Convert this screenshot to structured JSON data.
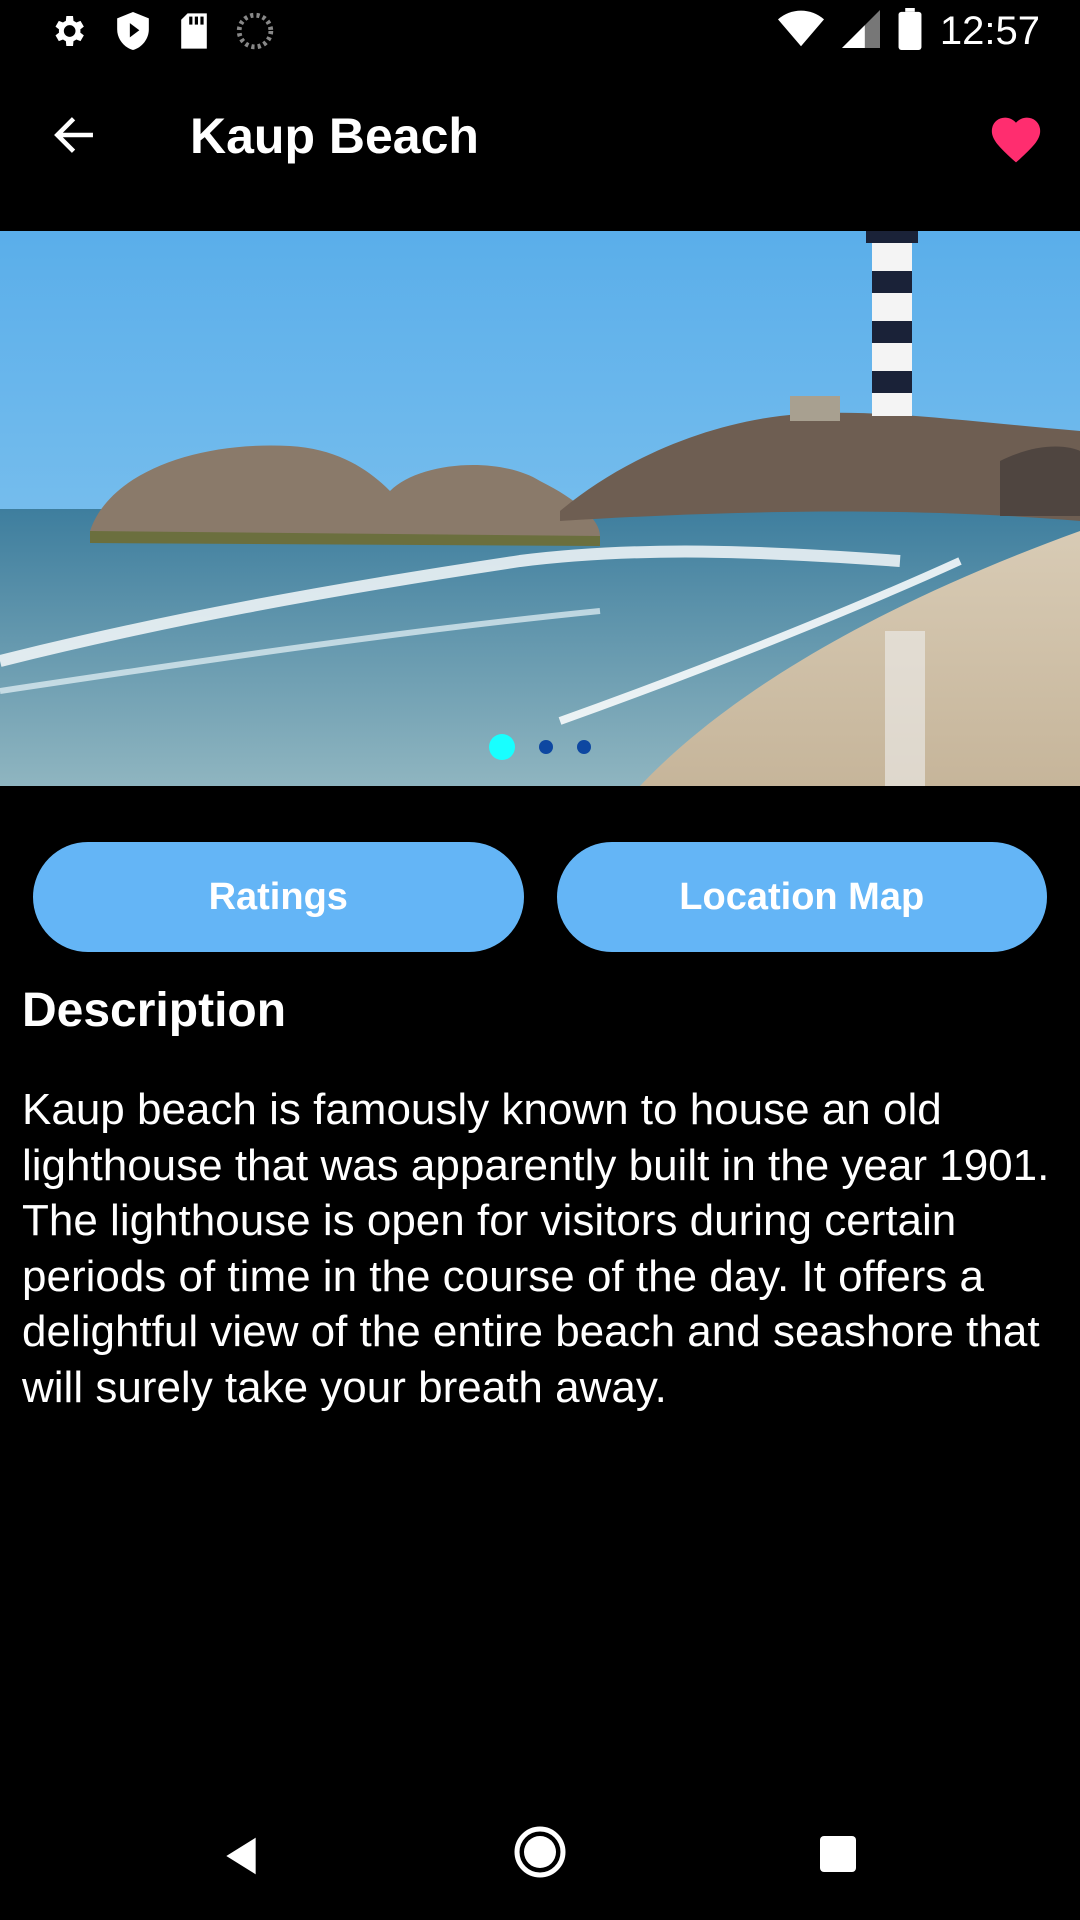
{
  "status_bar": {
    "time": "12:57",
    "left_icons": [
      "gear-icon",
      "shield-icon",
      "sd-card-icon",
      "loading-icon"
    ],
    "right_icons": [
      "wifi-icon",
      "signal-icon",
      "battery-icon"
    ]
  },
  "app_bar": {
    "title": "Kaup Beach",
    "back_icon": "arrow-back-icon",
    "favorite_icon": "heart-icon",
    "favorite_color": "#ff2d6f"
  },
  "carousel": {
    "image_alt": "Kaup beach lighthouse",
    "page_count": 3,
    "active_index": 0,
    "active_dot_color": "#18ffff",
    "inactive_dot_color": "#0d47a1"
  },
  "actions": {
    "ratings_label": "Ratings",
    "location_label": "Location Map",
    "button_color": "#64b5f6"
  },
  "description": {
    "heading": "Description",
    "body": "Kaup beach is famously known to house an old lighthouse that was apparently built in the year 1901. The lighthouse is open for visitors during certain periods of time in the course of the day. It offers a delightful view of the entire beach and seashore that will surely take your breath away."
  },
  "nav_bar": {
    "icons": [
      "nav-back-icon",
      "nav-home-icon",
      "nav-recents-icon"
    ]
  }
}
